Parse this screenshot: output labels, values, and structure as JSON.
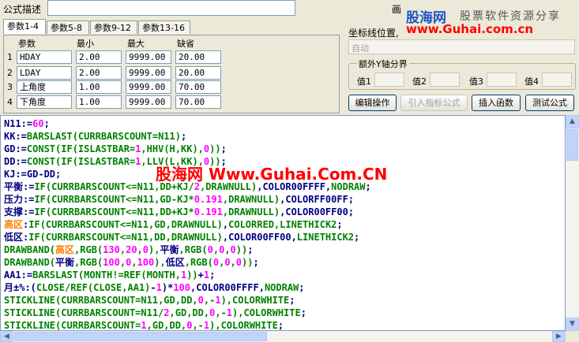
{
  "header": {
    "formula_desc_label": "公式描述",
    "formula_desc_value": "",
    "draw_label": "画"
  },
  "tabs": [
    {
      "label": "参数1-4"
    },
    {
      "label": "参数5-8"
    },
    {
      "label": "参数9-12"
    },
    {
      "label": "参数13-16"
    }
  ],
  "param_headers": {
    "name": "参数",
    "min": "最小",
    "max": "最大",
    "default": "缺省"
  },
  "params": [
    {
      "no": "1",
      "name": "HDAY",
      "min": "2.00",
      "max": "9999.00",
      "def": "20.00"
    },
    {
      "no": "2",
      "name": "LDAY",
      "min": "2.00",
      "max": "9999.00",
      "def": "20.00"
    },
    {
      "no": "3",
      "name": "上角度",
      "min": "1.00",
      "max": "9999.00",
      "def": "70.00"
    },
    {
      "no": "4",
      "name": "下角度",
      "min": "1.00",
      "max": "9999.00",
      "def": "70.00"
    }
  ],
  "coord": {
    "label": "坐标线位置,",
    "value": "自动"
  },
  "extra_y": {
    "label": "额外Y轴分界",
    "v1": "值1",
    "v2": "值2",
    "v3": "值3",
    "v4": "值4"
  },
  "buttons": {
    "edit": "编辑操作",
    "import": "引入指标公式",
    "insert": "插入函数",
    "test": "测试公式"
  },
  "watermark": {
    "logo": "股海网",
    "slogan": "股票软件资源分享",
    "url": "www.Guhai.com.cn",
    "center": "股海网 Www.Guhai.Com.CN"
  },
  "code_lines": [
    "N11:=60;",
    "KK:=BARSLAST(CURRBARSCOUNT=N11);",
    "GD:=CONST(IF(ISLASTBAR=1,HHV(H,KK),0));",
    "DD:=CONST(IF(ISLASTBAR=1,LLV(L,KK),0));",
    "KJ:=GD-DD;",
    "平衡:=IF(CURRBARSCOUNT<=N11,DD+KJ/2,DRAWNULL),COLOR00FFFF,NODRAW;",
    "压力:=IF(CURRBARSCOUNT<=N11,GD-KJ*0.191,DRAWNULL),COLORFF00FF;",
    "支撑:=IF(CURRBARSCOUNT<=N11,DD+KJ*0.191,DRAWNULL),COLOR00FF00;",
    "高区:IF(CURRBARSCOUNT<=N11,GD,DRAWNULL),COLORRED,LINETHICK2;",
    "低区:IF(CURRBARSCOUNT<=N11,DD,DRAWNULL),COLOR00FF00,LINETHICK2;",
    "DRAWBAND(高区,RGB(130,20,0),平衡,RGB(0,0,0));",
    "DRAWBAND(平衡,RGB(100,0,100),低区,RGB(0,0,0));",
    "AA1:=BARSLAST(MONTH!=REF(MONTH,1))+1;",
    "月±%:(CLOSE/REF(CLOSE,AA1)-1)*100,COLOR00FFFF,NODRAW;",
    "STICKLINE(CURRBARSCOUNT=N11,GD,DD,0,-1),COLORWHITE;",
    "STICKLINE(CURRBARSCOUNT=N11/2,GD,DD,0,-1),COLORWHITE;",
    "STICKLINE(CURRBARSCOUNT=1,GD,DD,0,-1),COLORWHITE;"
  ],
  "colors": {
    "keyword": "#000080",
    "number": "#ff00ff",
    "builtin": "#008000",
    "watermark_red": "#ff0000",
    "watermark_blue": "#0000ff"
  }
}
